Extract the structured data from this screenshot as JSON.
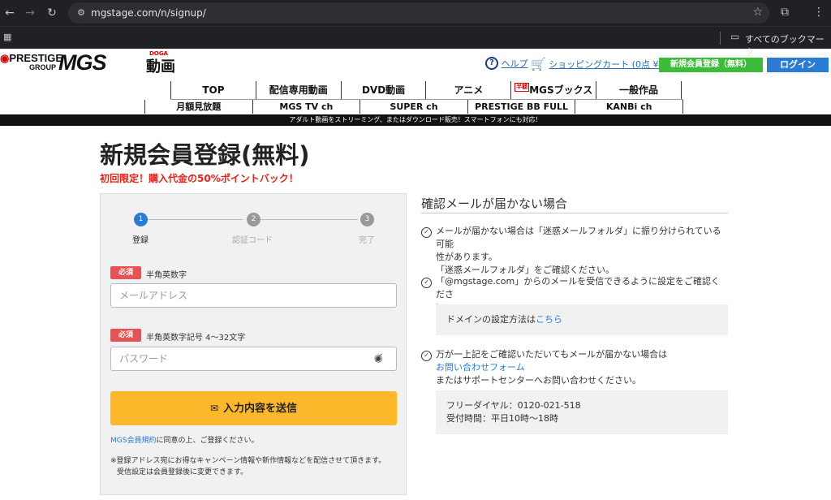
{
  "browser": {
    "url": "mgstage.com/n/signup/",
    "bookmarks_label": "すべてのブックマーク"
  },
  "header": {
    "logo_prestige": "PRESTIGE",
    "logo_group": "GROUP",
    "logo_mgs": "MGS",
    "logo_douga": "動画",
    "logo_doga": "DOGA",
    "help": "ヘルプ",
    "cart": "ショッピングカート (0点 ¥0)",
    "register_button": "新規会員登録（無料）",
    "login_button": "ログイン"
  },
  "nav": {
    "main": [
      "TOP",
      "配信専用動画",
      "DVD動画",
      "アニメ",
      "MGSブックス",
      "一般作品"
    ],
    "books_tag": "半額",
    "sub": [
      "月額見放題",
      "MGS TV ch",
      "SUPER ch",
      "PRESTIGE BB FULL",
      "KANBi ch"
    ]
  },
  "banner": "アダルト動画をストリーミング、またはダウンロード販売！スマートフォンにも対応！",
  "main": {
    "title": "新規会員登録(無料)",
    "subtitle": "初回限定！購入代金の50%ポイントバック！"
  },
  "form": {
    "steps": [
      {
        "num": "1",
        "label": "登録"
      },
      {
        "num": "2",
        "label": "認証コード"
      },
      {
        "num": "3",
        "label": "完了"
      }
    ],
    "required_badge": "必須",
    "email_hint": "半角英数字",
    "email_placeholder": "メールアドレス",
    "password_hint": "半角英数字記号 4～32文字",
    "password_placeholder": "パスワード",
    "submit_label": "入力内容を送信",
    "terms_link": "MGS会員規約",
    "terms_text": "に同意の上、ご登録ください。",
    "note_line1": "※登録アドレス宛にお得なキャンペーン情報や新作情報などを配信させて頂きます。",
    "note_line2": "受信設定は会員登録後に変更できます。"
  },
  "side": {
    "title": "確認メールが届かない場合",
    "item1_line1": "メールが届かない場合は「迷惑メールフォルダ」に振り分けられている可能",
    "item1_line2": "性があります。",
    "item1_line3": "「迷惑メールフォルダ」をご確認ください。",
    "item2_line1": "「@mgstage.com」からのメールを受信できるように設定をご確認くださ",
    "item2_line2": "い。",
    "domain_text": "ドメインの設定方法は",
    "domain_link": "こちら",
    "item3_line1": "万が一上記をご確認いただいてもメールが届かない場合は",
    "item3_link": "お問い合わせフォーム",
    "item3_line3": "またはサポートセンターへお問い合わせください。",
    "freedial": "フリーダイヤル：0120-021-518",
    "hours": "受付時間：平日10時～18時"
  }
}
